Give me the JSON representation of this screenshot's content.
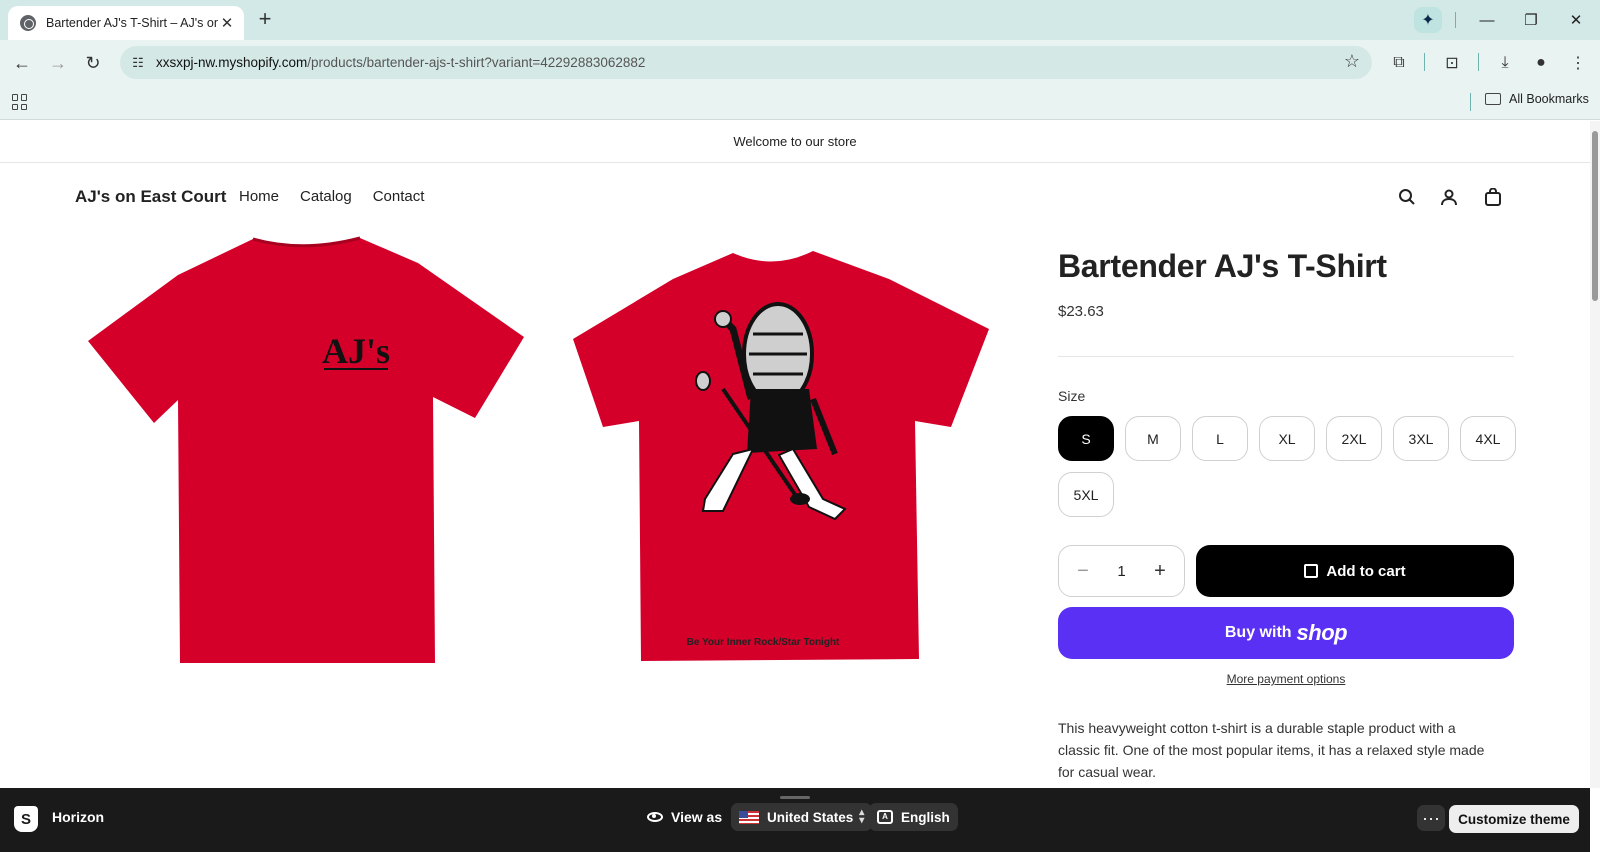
{
  "browser": {
    "tab_title": "Bartender AJ's T-Shirt – AJ's on",
    "url_host": "xxsxpj-nw.myshopify.com",
    "url_path": "/products/bartender-ajs-t-shirt?variant=42292883062882",
    "all_bookmarks": "All Bookmarks"
  },
  "store": {
    "announcement": "Welcome to our store",
    "brand": "AJ's on East Court",
    "nav": [
      "Home",
      "Catalog",
      "Contact"
    ]
  },
  "product": {
    "title": "Bartender AJ's T-Shirt",
    "price": "$23.63",
    "size_label": "Size",
    "sizes": [
      "S",
      "M",
      "L",
      "XL",
      "2XL",
      "3XL",
      "4XL",
      "5XL"
    ],
    "selected_size": "S",
    "quantity": "1",
    "add_to_cart": "Add to cart",
    "buy_with": "Buy with",
    "shop_word": "shop",
    "more_payment": "More payment options",
    "description": "This heavyweight cotton t-shirt is a durable staple product with a classic fit. One of the most popular items, it has a relaxed style made for casual wear.",
    "front_print": "AJ's",
    "back_print": "Be Your Inner Rock/Star Tonight",
    "shirt_color": "#d4002a"
  },
  "editor_bar": {
    "theme": "Horizon",
    "view_as": "View as",
    "country": "United States",
    "language": "English",
    "customize": "Customize theme"
  },
  "colors": {
    "buy_button": "#5a31f4",
    "tab_strip": "#d3e9e7"
  }
}
